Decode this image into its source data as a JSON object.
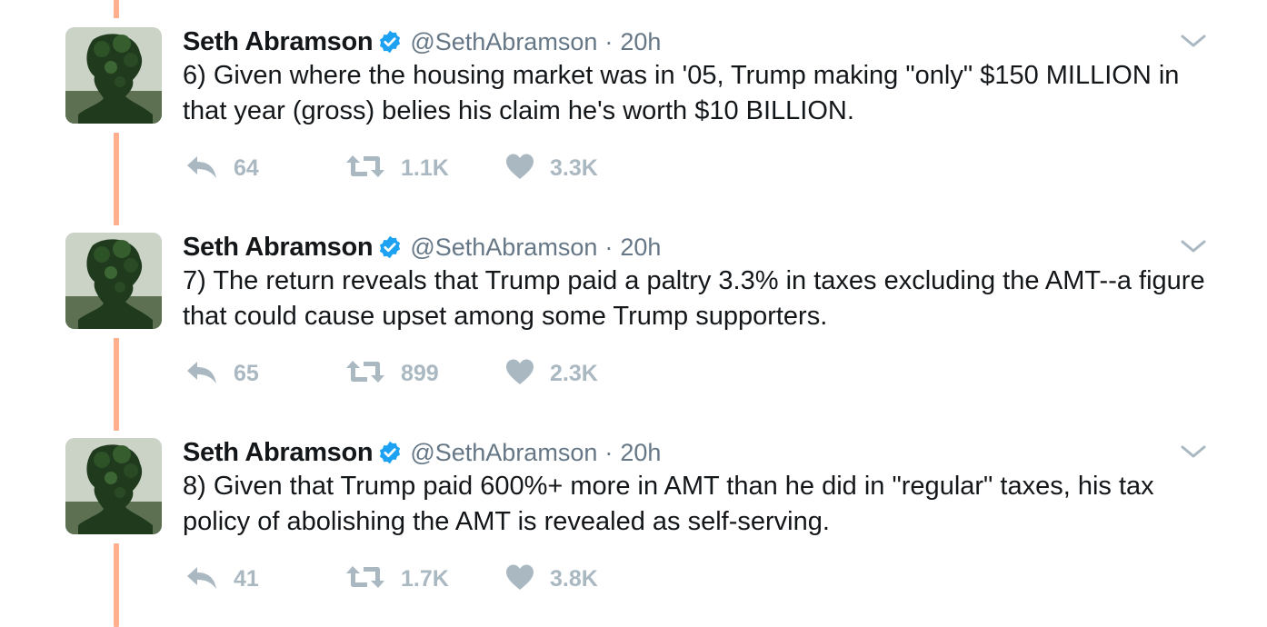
{
  "colors": {
    "thread_line": "#fdaf8e",
    "verified": "#1da1f2",
    "action_icon": "#aab8c2",
    "text": "#14171a",
    "secondary": "#657786"
  },
  "tweets": [
    {
      "author_name": "Seth Abramson",
      "handle": "@SethAbramson",
      "separator": "·",
      "time": "20h",
      "text": "6) Given where the housing market was in '05, Trump making \"only\" $150 MILLION in that year (gross) belies his claim he's worth $10 BILLION.",
      "replies": "64",
      "retweets": "1.1K",
      "likes": "3.3K"
    },
    {
      "author_name": "Seth Abramson",
      "handle": "@SethAbramson",
      "separator": "·",
      "time": "20h",
      "text": "7) The return reveals that Trump paid a paltry 3.3% in taxes excluding the AMT--a figure that could cause upset among some Trump supporters.",
      "replies": "65",
      "retweets": "899",
      "likes": "2.3K"
    },
    {
      "author_name": "Seth Abramson",
      "handle": "@SethAbramson",
      "separator": "·",
      "time": "20h",
      "text": "8) Given that Trump paid 600%+ more in AMT than he did in \"regular\" taxes, his tax policy of abolishing the AMT is revealed as self-serving.",
      "replies": "41",
      "retweets": "1.7K",
      "likes": "3.8K"
    }
  ],
  "icons": {
    "verified": "verified-badge-icon",
    "caret": "chevron-down-icon",
    "reply": "reply-icon",
    "retweet": "retweet-icon",
    "like": "heart-icon"
  }
}
